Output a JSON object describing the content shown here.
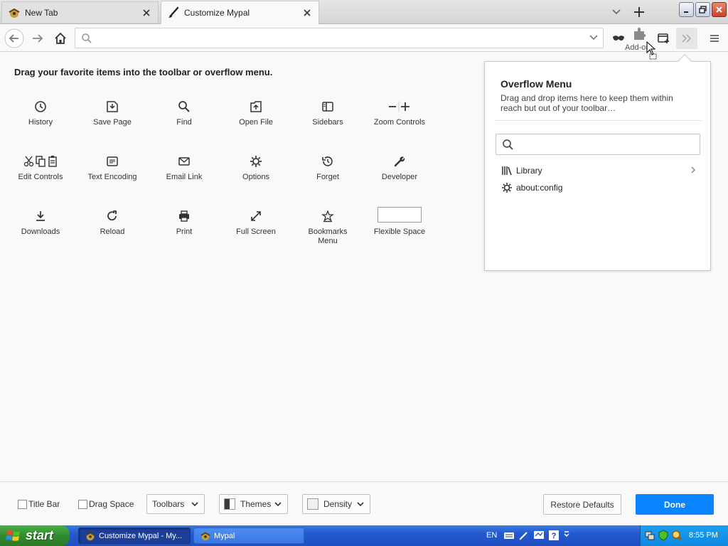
{
  "browser": {
    "tabs": [
      {
        "title": "New Tab",
        "active": false
      },
      {
        "title": "Customize Mypal",
        "active": true
      }
    ],
    "url": {
      "value": "",
      "placeholder": ""
    },
    "addons_label": "Add-ons"
  },
  "customize": {
    "heading": "Drag your favorite items into the toolbar or overflow menu.",
    "palette": [
      {
        "label": "History",
        "icon": "history-icon"
      },
      {
        "label": "Save Page",
        "icon": "save-page-icon"
      },
      {
        "label": "Find",
        "icon": "find-icon"
      },
      {
        "label": "Open File",
        "icon": "open-file-icon"
      },
      {
        "label": "Sidebars",
        "icon": "sidebars-icon"
      },
      {
        "label": "Zoom Controls",
        "icon": "zoom-controls-icon"
      },
      {
        "label": "Edit Controls",
        "icon": "edit-controls-icon"
      },
      {
        "label": "Text Encoding",
        "icon": "text-encoding-icon"
      },
      {
        "label": "Email Link",
        "icon": "email-link-icon"
      },
      {
        "label": "Options",
        "icon": "options-icon"
      },
      {
        "label": "Forget",
        "icon": "forget-icon"
      },
      {
        "label": "Developer",
        "icon": "developer-icon"
      },
      {
        "label": "Downloads",
        "icon": "downloads-icon"
      },
      {
        "label": "Reload",
        "icon": "reload-icon"
      },
      {
        "label": "Print",
        "icon": "print-icon"
      },
      {
        "label": "Full Screen",
        "icon": "full-screen-icon"
      },
      {
        "label": "Bookmarks Menu",
        "icon": "bookmarks-menu-icon"
      },
      {
        "label": "Flexible Space",
        "icon": "flexible-space-icon"
      }
    ]
  },
  "overflow": {
    "title": "Overflow Menu",
    "description": "Drag and drop items here to keep them within reach but out of your toolbar…",
    "search": {
      "value": "",
      "placeholder": ""
    },
    "items": [
      {
        "label": "Library",
        "icon": "library-icon"
      },
      {
        "label": "about:config",
        "icon": "gear-icon"
      }
    ]
  },
  "footer": {
    "title_bar": {
      "label": "Title Bar",
      "checked": false
    },
    "drag_space": {
      "label": "Drag Space",
      "checked": false
    },
    "toolbars": "Toolbars",
    "themes": "Themes",
    "density": "Density",
    "restore": "Restore Defaults",
    "done": "Done"
  },
  "taskbar": {
    "start": "start",
    "tasks": [
      {
        "label": "Customize Mypal - My...",
        "active": true
      },
      {
        "label": "Mypal",
        "active": false
      }
    ],
    "language": "EN",
    "clock": "8:55 PM"
  },
  "colors": {
    "accent": "#0a84ff",
    "taskbar": "#2459cf",
    "start": "#328a2d"
  }
}
